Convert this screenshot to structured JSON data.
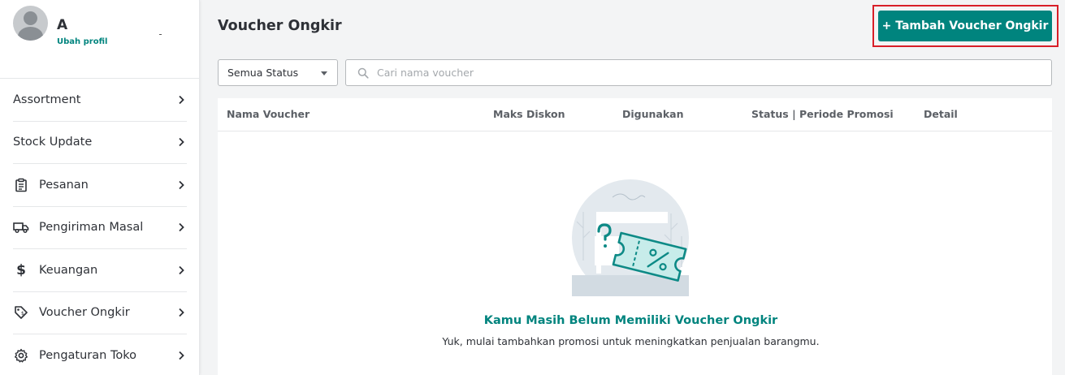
{
  "profile": {
    "name": "A",
    "edit_link": "Ubah profil"
  },
  "sidebar": {
    "items": [
      {
        "label": "Assortment",
        "icon": "none"
      },
      {
        "label": "Stock Update",
        "icon": "none"
      },
      {
        "label": "Pesanan",
        "icon": "clipboard-icon"
      },
      {
        "label": "Pengiriman Masal",
        "icon": "truck-icon"
      },
      {
        "label": "Keuangan",
        "icon": "dollar-icon"
      },
      {
        "label": "Voucher Ongkir",
        "icon": "voucher-tag-icon"
      },
      {
        "label": "Pengaturan Toko",
        "icon": "gear-icon"
      }
    ]
  },
  "header": {
    "title": "Voucher Ongkir",
    "add_button_label": "+ Tambah Voucher Ongkir"
  },
  "filters": {
    "status_selected": "Semua Status",
    "search_placeholder": "Cari nama voucher",
    "search_value": ""
  },
  "table": {
    "columns": [
      "Nama Voucher",
      "Maks Diskon",
      "Digunakan",
      "Status | Periode Promosi",
      "Detail"
    ],
    "rows": []
  },
  "empty_state": {
    "title": "Kamu Masih Belum Memiliki Voucher Ongkir",
    "subtitle": "Yuk, mulai tambahkan promosi untuk meningkatkan penjualan barangmu."
  },
  "colors": {
    "accent": "#00847e",
    "highlight": "#d81f28",
    "background": "#f3f4f5"
  }
}
